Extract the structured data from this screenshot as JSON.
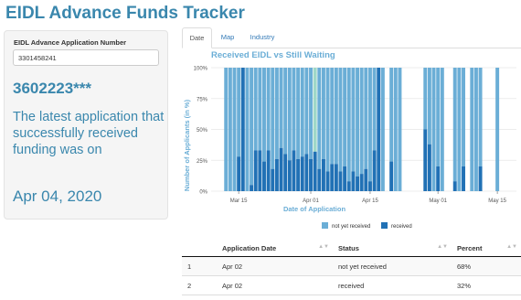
{
  "app_title": "EIDL Advance Funds Tracker",
  "sidebar": {
    "input_label": "EIDL Advance Application Number",
    "input_value": "3301458241",
    "masked_number": "3602223***",
    "latest_text": "The latest application that successfully received funding was on",
    "latest_date": "Apr 04, 2020"
  },
  "tabs": [
    {
      "label": "Date",
      "active": true
    },
    {
      "label": "Map",
      "active": false
    },
    {
      "label": "Industry",
      "active": false
    }
  ],
  "chart_data": {
    "type": "bar",
    "stacked": true,
    "title": "Received EIDL vs Still Waiting",
    "xlabel": "Date of Application",
    "ylabel": "Number of Applicants (in %)",
    "ylim": [
      0,
      100
    ],
    "y_ticks": [
      "0%",
      "25%",
      "50%",
      "75%",
      "100%"
    ],
    "x_ticks": [
      {
        "label": "Mar 15",
        "date": "2020-03-15"
      },
      {
        "label": "Apr 01",
        "date": "2020-04-01"
      },
      {
        "label": "Apr 15",
        "date": "2020-04-15"
      },
      {
        "label": "May 01",
        "date": "2020-05-01"
      },
      {
        "label": "May 15",
        "date": "2020-05-15"
      }
    ],
    "highlight_date": "2020-04-02",
    "series": [
      {
        "name": "not yet received",
        "color": "#6baed6"
      },
      {
        "name": "received",
        "color": "#2171b5"
      }
    ],
    "dates": [
      "2020-03-12",
      "2020-03-13",
      "2020-03-14",
      "2020-03-15",
      "2020-03-16",
      "2020-03-17",
      "2020-03-18",
      "2020-03-19",
      "2020-03-20",
      "2020-03-21",
      "2020-03-22",
      "2020-03-23",
      "2020-03-24",
      "2020-03-25",
      "2020-03-26",
      "2020-03-27",
      "2020-03-28",
      "2020-03-29",
      "2020-03-30",
      "2020-03-31",
      "2020-04-01",
      "2020-04-02",
      "2020-04-03",
      "2020-04-04",
      "2020-04-05",
      "2020-04-06",
      "2020-04-07",
      "2020-04-08",
      "2020-04-09",
      "2020-04-10",
      "2020-04-11",
      "2020-04-12",
      "2020-04-13",
      "2020-04-14",
      "2020-04-15",
      "2020-04-16",
      "2020-04-17",
      "2020-04-18",
      "2020-04-20",
      "2020-04-21",
      "2020-04-22",
      "2020-04-28",
      "2020-04-29",
      "2020-04-30",
      "2020-05-01",
      "2020-05-02",
      "2020-05-05",
      "2020-05-06",
      "2020-05-07",
      "2020-05-09",
      "2020-05-10",
      "2020-05-11",
      "2020-05-15"
    ],
    "received": [
      0,
      0,
      0,
      28,
      100,
      0,
      5,
      33,
      33,
      24,
      33,
      18,
      26,
      35,
      30,
      25,
      33,
      26,
      28,
      30,
      26,
      32,
      18,
      26,
      16,
      22,
      22,
      16,
      20,
      8,
      16,
      12,
      14,
      18,
      8,
      33,
      100,
      0,
      24,
      0,
      0,
      50,
      38,
      0,
      20,
      0,
      8,
      0,
      20,
      0,
      0,
      20,
      0
    ]
  },
  "table": {
    "headers": [
      "",
      "Application Date",
      "Status",
      "Percent"
    ],
    "rows": [
      [
        "1",
        "Apr 02",
        "not yet received",
        "68%"
      ],
      [
        "2",
        "Apr 02",
        "received",
        "32%"
      ]
    ]
  }
}
